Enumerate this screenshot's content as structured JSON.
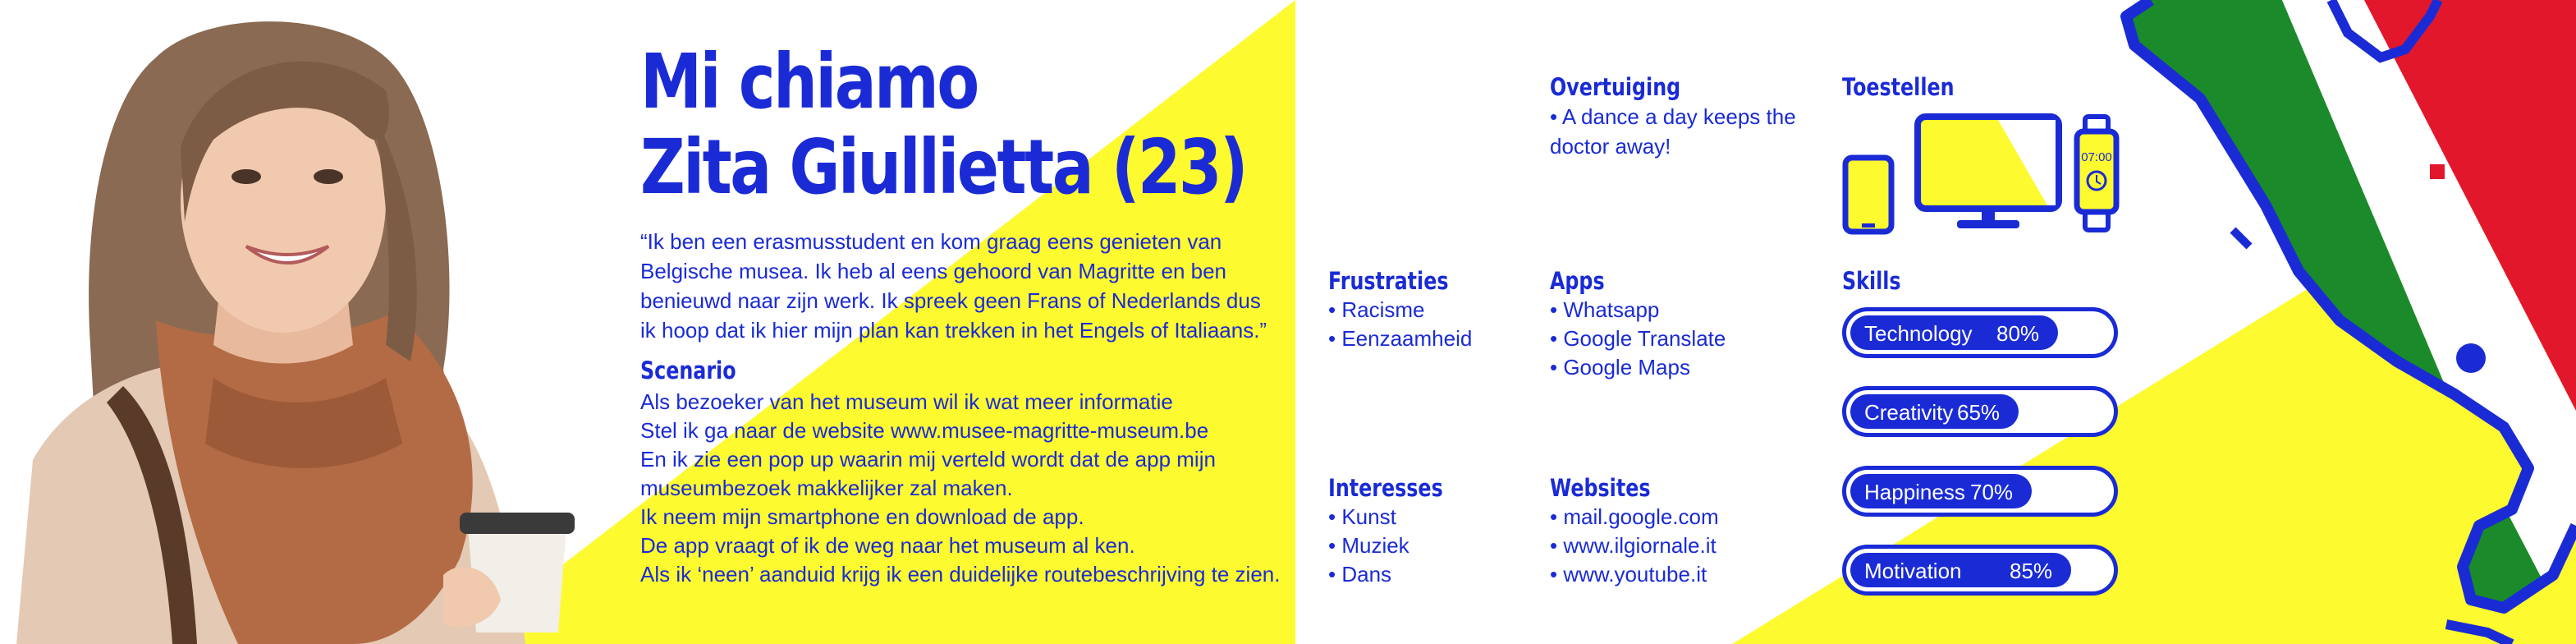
{
  "colors": {
    "accent": "#1a2bd6",
    "yellow": "#fdfa2f",
    "italy_green": "#1b8a2a",
    "italy_red": "#e3172b"
  },
  "profile": {
    "title_line1": "Mi chiamo",
    "title_line2": "Zita Giullietta (23)",
    "quote": "“Ik ben een erasmusstudent en kom graag eens genieten van Belgische musea. Ik heb al eens gehoord van Magritte en ben benieuwd naar zijn werk. Ik spreek geen Frans of Nederlands dus ik hoop dat ik hier mijn plan kan trekken in het Engels of Italiaans.”"
  },
  "scenario": {
    "heading": "Scenario",
    "lines": [
      "Als bezoeker van het museum wil ik wat meer informatie",
      "Stel ik ga naar de website www.musee-magritte-museum.be",
      "En ik zie een pop up waarin mij verteld wordt dat de app mijn",
      "museumbezoek makkelijker zal maken.",
      "Ik neem mijn smartphone en download de app.",
      "De app vraagt of ik de weg naar het museum al ken.",
      "Als ik ‘neen’ aanduid krijg ik een duidelijke routebeschrijving te zien."
    ]
  },
  "overtuiging": {
    "heading": "Overtuiging",
    "text": "A dance a day keeps the doctor away!"
  },
  "toestellen": {
    "heading": "Toestellen",
    "watch_time": "07:00",
    "icons": [
      "smartphone-icon",
      "monitor-icon",
      "smartwatch-icon"
    ]
  },
  "frustraties": {
    "heading": "Frustraties",
    "items": [
      "Racisme",
      "Eenzaamheid"
    ]
  },
  "apps": {
    "heading": "Apps",
    "items": [
      "Whatsapp",
      "Google Translate",
      "Google Maps"
    ]
  },
  "interesses": {
    "heading": "Interesses",
    "items": [
      "Kunst",
      "Muziek",
      "Dans"
    ]
  },
  "websites": {
    "heading": "Websites",
    "items": [
      "mail.google.com",
      "www.ilgiornale.it",
      "www.youtube.it"
    ]
  },
  "skills": {
    "heading": "Skills",
    "items": [
      {
        "name": "Technology",
        "pct_label": "80%",
        "value": 0.8
      },
      {
        "name": "Creativity",
        "pct_label": "65%",
        "value": 0.65
      },
      {
        "name": "Happiness",
        "pct_label": "70%",
        "value": 0.7
      },
      {
        "name": "Motivation",
        "pct_label": "85%",
        "value": 0.85
      }
    ]
  }
}
